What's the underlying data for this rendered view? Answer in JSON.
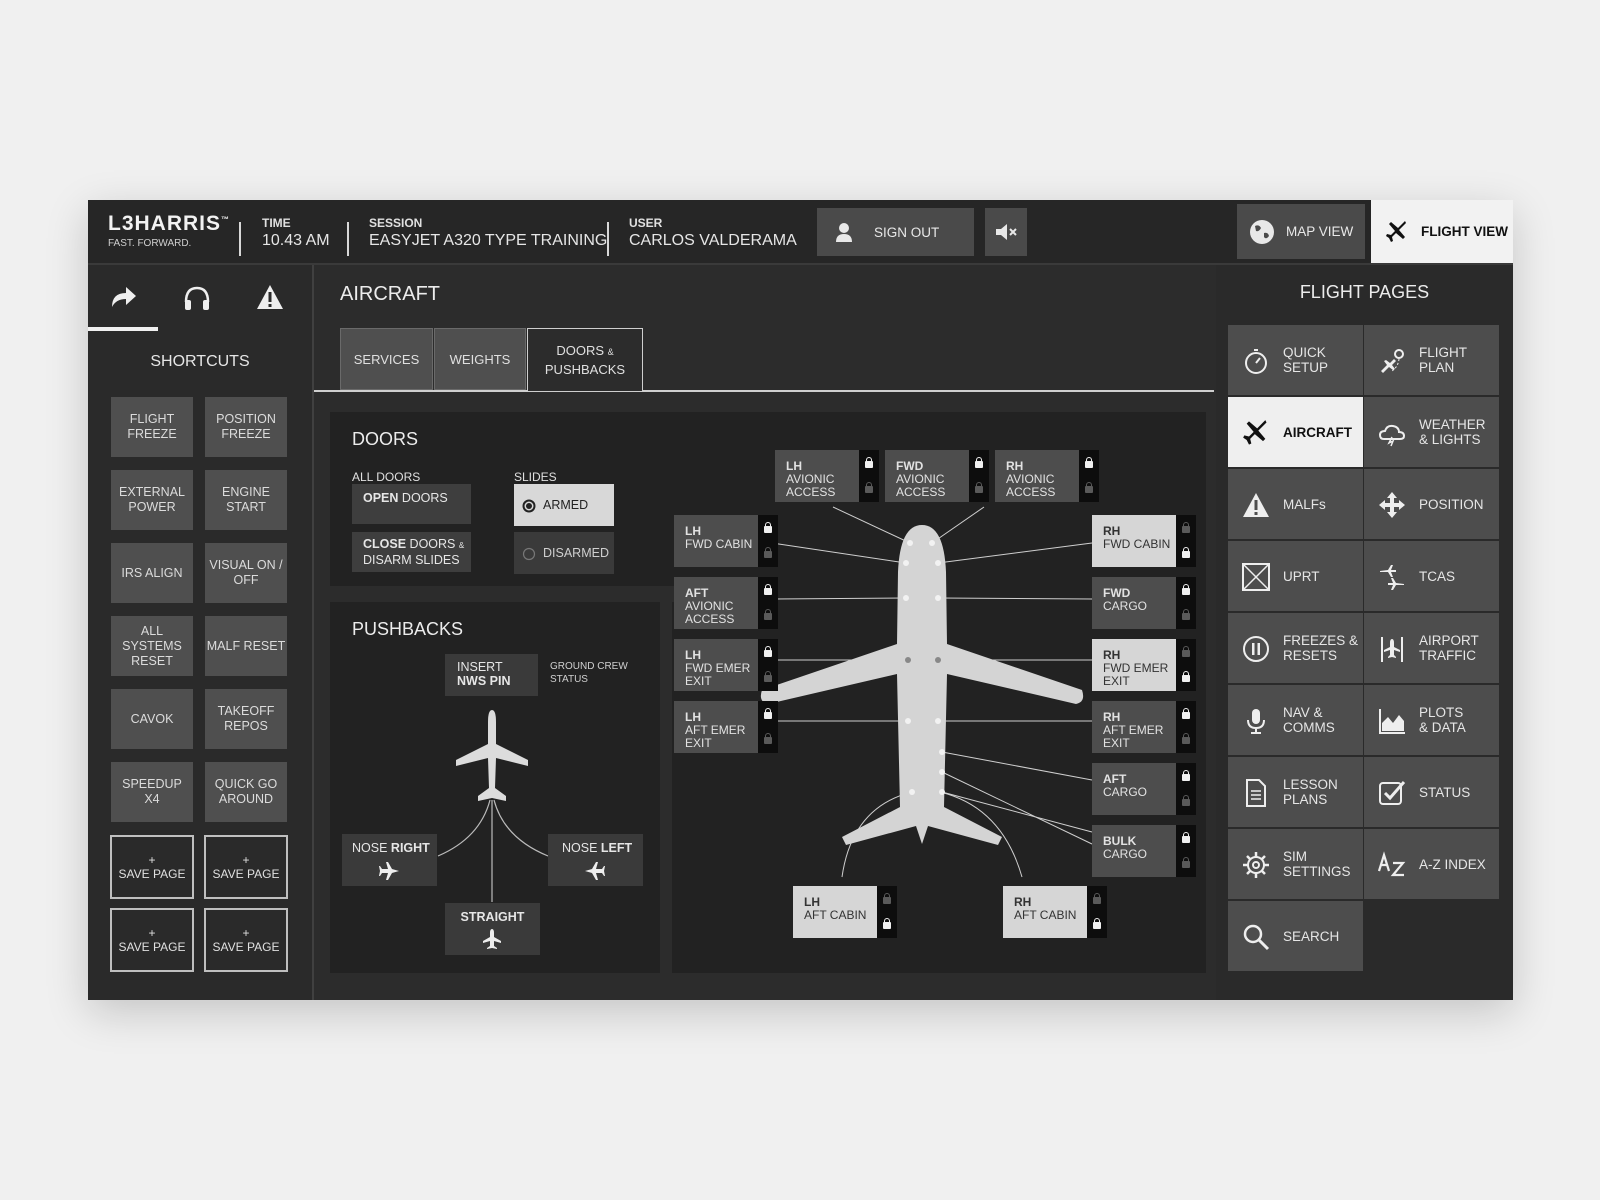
{
  "header": {
    "brand": "L3HARRIS",
    "brand_tm": "™",
    "tagline": "FAST. FORWARD.",
    "time_label": "TIME",
    "time_value": "10.43 AM",
    "session_label": "SESSION",
    "session_value": "EASYJET A320 TYPE TRAINING",
    "user_label": "USER",
    "user_value": "CARLOS VALDERAMA",
    "sign_out": "SIGN OUT",
    "map_view": "MAP VIEW",
    "flight_view": "FLIGHT VIEW"
  },
  "sidebar": {
    "title": "SHORTCUTS",
    "shortcuts": [
      {
        "l1": "FLIGHT",
        "l2": "FREEZE"
      },
      {
        "l1": "POSITION",
        "l2": "FREEZE"
      },
      {
        "l1": "EXTERNAL",
        "l2": "POWER"
      },
      {
        "l1": "ENGINE",
        "l2": "START"
      },
      {
        "l1": "IRS ALIGN",
        "l2": ""
      },
      {
        "l1": "VISUAL ON /",
        "l2": "OFF"
      },
      {
        "l1": "ALL",
        "l2": "SYSTEMS",
        "l3": "RESET"
      },
      {
        "l1": "MALF RESET",
        "l2": ""
      },
      {
        "l1": "CAVOK",
        "l2": ""
      },
      {
        "l1": "TAKEOFF",
        "l2": "REPOS"
      },
      {
        "l1": "SPEEDUP",
        "l2": "X4"
      },
      {
        "l1": "QUICK GO",
        "l2": "AROUND"
      }
    ],
    "save_plus": "+",
    "save_page": "SAVE PAGE"
  },
  "main": {
    "title": "AIRCRAFT",
    "tabs": {
      "services": "SERVICES",
      "weights": "WEIGHTS",
      "doors_l1": "DOORS",
      "doors_amp": "&",
      "doors_l2": "PUSHBACKS"
    },
    "doors": {
      "title": "DOORS",
      "all_doors": "ALL DOORS",
      "open_b": "OPEN",
      "open_r": "DOORS",
      "close_b": "CLOSE",
      "close_r": "DOORS",
      "close_amp": "&",
      "close_l2": "DISARM SLIDES",
      "slides": "SLIDES",
      "armed": "ARMED",
      "disarmed": "DISARMED"
    },
    "pushbacks": {
      "title": "PUSHBACKS",
      "insert": "INSERT",
      "nws_pin": "NWS PIN",
      "ground_crew_1": "GROUND CREW",
      "ground_crew_2": "STATUS",
      "nose_right_a": "NOSE",
      "nose_right_b": "RIGHT",
      "nose_left_a": "NOSE",
      "nose_left_b": "LEFT",
      "straight": "STRAIGHT"
    },
    "door_tiles": {
      "lh_avionic": {
        "b": "LH",
        "l2": "AVIONIC",
        "l3": "ACCESS"
      },
      "fwd_avionic": {
        "b": "FWD",
        "l2": "AVIONIC",
        "l3": "ACCESS"
      },
      "rh_avionic": {
        "b": "RH",
        "l2": "AVIONIC",
        "l3": "ACCESS"
      },
      "lh_fwd_cabin": {
        "b": "LH",
        "l2": "FWD CABIN",
        "l3": ""
      },
      "aft_avionic": {
        "b": "AFT",
        "l2": "AVIONIC",
        "l3": "ACCESS"
      },
      "lh_fwd_emer": {
        "b": "LH",
        "l2": "FWD EMER",
        "l3": "EXIT"
      },
      "lh_aft_emer": {
        "b": "LH",
        "l2": "AFT EMER",
        "l3": "EXIT"
      },
      "rh_fwd_cabin": {
        "b": "RH",
        "l2": "FWD CABIN",
        "l3": ""
      },
      "fwd_cargo": {
        "b": "FWD",
        "l2": "CARGO",
        "l3": ""
      },
      "rh_fwd_emer": {
        "b": "RH",
        "l2": "FWD EMER",
        "l3": "EXIT"
      },
      "rh_aft_emer": {
        "b": "RH",
        "l2": "AFT EMER",
        "l3": "EXIT"
      },
      "aft_cargo": {
        "b": "AFT",
        "l2": "CARGO",
        "l3": ""
      },
      "bulk_cargo": {
        "b": "BULK",
        "l2": "CARGO",
        "l3": ""
      },
      "lh_aft_cabin": {
        "b": "LH",
        "l2": "AFT CABIN",
        "l3": ""
      },
      "rh_aft_cabin": {
        "b": "RH",
        "l2": "AFT CABIN",
        "l3": ""
      }
    }
  },
  "flight_pages": {
    "title": "FLIGHT PAGES",
    "items": [
      {
        "l1": "QUICK",
        "l2": "SETUP"
      },
      {
        "l1": "FLIGHT",
        "l2": "PLAN"
      },
      {
        "l1": "AIRCRAFT",
        "l2": ""
      },
      {
        "l1": "WEATHER",
        "l2": "& LIGHTS"
      },
      {
        "l1": "MALFs",
        "l2": ""
      },
      {
        "l1": "POSITION",
        "l2": ""
      },
      {
        "l1": "UPRT",
        "l2": ""
      },
      {
        "l1": "TCAS",
        "l2": ""
      },
      {
        "l1": "FREEZES &",
        "l2": "RESETS"
      },
      {
        "l1": "AIRPORT",
        "l2": "TRAFFIC"
      },
      {
        "l1": "NAV &",
        "l2": "COMMS"
      },
      {
        "l1": "PLOTS",
        "l2": "& DATA"
      },
      {
        "l1": "LESSON",
        "l2": "PLANS"
      },
      {
        "l1": "STATUS",
        "l2": ""
      },
      {
        "l1": "SIM",
        "l2": "SETTINGS"
      },
      {
        "l1": "A-Z INDEX",
        "l2": ""
      },
      {
        "l1": "SEARCH",
        "l2": ""
      }
    ]
  },
  "colors": {
    "background": "#f0f0f0",
    "app": "#2c2c2c",
    "button": "#4d4d4d",
    "selected": "#efefef",
    "panel": "#222222"
  }
}
